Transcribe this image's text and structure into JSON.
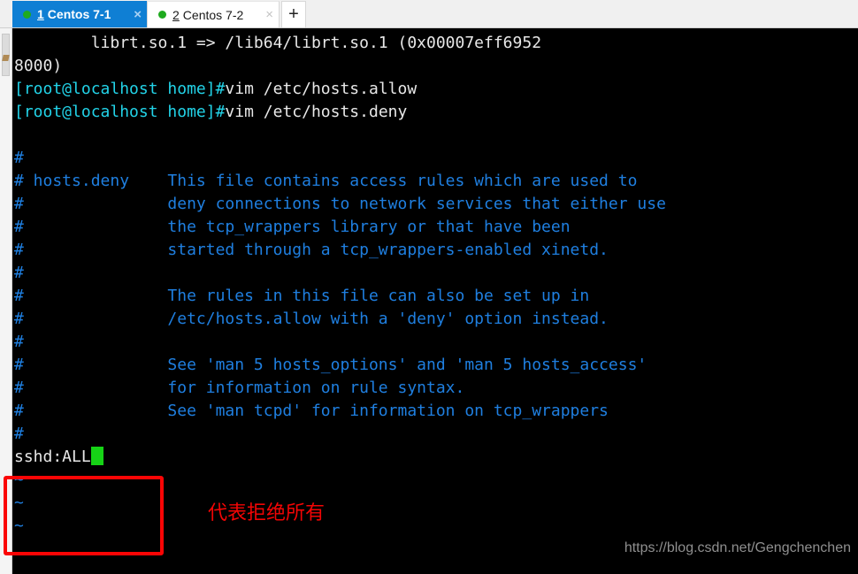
{
  "window": {
    "title": "Centos 7-1"
  },
  "tabbar": {
    "tabs": [
      {
        "number": "1",
        "label": "Centos 7-1",
        "close": "×",
        "active": true,
        "status": "connected"
      },
      {
        "number": "2",
        "label": "Centos 7-2",
        "close": "×",
        "active": false,
        "status": "connected"
      }
    ],
    "new_tab_label": "+"
  },
  "terminal": {
    "lines": [
      {
        "segments": [
          {
            "text": "        librt.so.1 => /lib64/librt.so.1 (0x00007eff6952",
            "color": "white"
          }
        ]
      },
      {
        "segments": [
          {
            "text": "8000)",
            "color": "white"
          }
        ]
      },
      {
        "segments": [
          {
            "text": "[root@localhost home]#",
            "color": "cyan"
          },
          {
            "text": "vim /etc/hosts.allow",
            "color": "white"
          }
        ]
      },
      {
        "segments": [
          {
            "text": "[root@localhost home]#",
            "color": "cyan"
          },
          {
            "text": "vim /etc/hosts.deny",
            "color": "white"
          }
        ]
      },
      {
        "segments": [
          {
            "text": "",
            "color": "white"
          }
        ]
      },
      {
        "segments": [
          {
            "text": "#",
            "color": "blue"
          }
        ]
      },
      {
        "segments": [
          {
            "text": "# hosts.deny    This file contains access rules which are used to",
            "color": "blue"
          }
        ]
      },
      {
        "segments": [
          {
            "text": "#               deny connections to network services that either use",
            "color": "blue"
          }
        ]
      },
      {
        "segments": [
          {
            "text": "#               the tcp_wrappers library or that have been",
            "color": "blue"
          }
        ]
      },
      {
        "segments": [
          {
            "text": "#               started through a tcp_wrappers-enabled xinetd.",
            "color": "blue"
          }
        ]
      },
      {
        "segments": [
          {
            "text": "#",
            "color": "blue"
          }
        ]
      },
      {
        "segments": [
          {
            "text": "#               The rules in this file can also be set up in",
            "color": "blue"
          }
        ]
      },
      {
        "segments": [
          {
            "text": "#               /etc/hosts.allow with a 'deny' option instead.",
            "color": "blue"
          }
        ]
      },
      {
        "segments": [
          {
            "text": "#",
            "color": "blue"
          }
        ]
      },
      {
        "segments": [
          {
            "text": "#               See 'man 5 hosts_options' and 'man 5 hosts_access'",
            "color": "blue"
          }
        ]
      },
      {
        "segments": [
          {
            "text": "#               for information on rule syntax.",
            "color": "blue"
          }
        ]
      },
      {
        "segments": [
          {
            "text": "#               See 'man tcpd' for information on tcp_wrappers",
            "color": "blue"
          }
        ]
      },
      {
        "segments": [
          {
            "text": "#",
            "color": "blue"
          }
        ]
      },
      {
        "segments": [
          {
            "text": "sshd:ALL",
            "color": "white"
          },
          {
            "cursor": true
          }
        ]
      },
      {
        "segments": [
          {
            "text": "~",
            "color": "blue"
          }
        ]
      },
      {
        "segments": [
          {
            "text": "~",
            "color": "blue"
          }
        ]
      },
      {
        "segments": [
          {
            "text": "~",
            "color": "blue"
          }
        ]
      }
    ]
  },
  "annotations": {
    "highlight_note": "代表拒绝所有"
  },
  "watermark": {
    "text": "https://blog.csdn.net/Gengchenchen"
  },
  "colors": {
    "tab_active_bg": "#0f7fd4",
    "terminal_bg": "#000000",
    "prompt_cyan": "#22d3e8",
    "comment_blue": "#1f7fe0",
    "cursor_green": "#16d316",
    "annotation_red": "#f20505",
    "status_dot_green": "#1faa1f"
  }
}
